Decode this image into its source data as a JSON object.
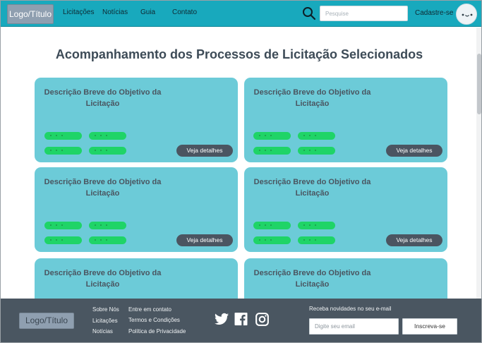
{
  "header": {
    "logo": "Logo/Título",
    "nav": [
      "Licitações",
      "Notícias",
      "Guia",
      "Contato"
    ],
    "search_placeholder": "Pesquise",
    "signup": "Cadastre-se"
  },
  "main": {
    "title": "Acompanhamento dos Processos de Licitação Selecionados",
    "cards": [
      {
        "title": "Descrição Breve do Objetivo da Licitação",
        "button": "Veja detalhes"
      },
      {
        "title": "Descrição Breve do Objetivo da Licitação",
        "button": "Veja detalhes"
      },
      {
        "title": "Descrição Breve do Objetivo da Licitação",
        "button": "Veja detalhes"
      },
      {
        "title": "Descrição Breve do Objetivo da Licitação",
        "button": "Veja detalhes"
      },
      {
        "title": "Descrição Breve do Objetivo da Licitação"
      },
      {
        "title": "Descrição Breve do Objetivo da Licitação"
      }
    ]
  },
  "footer": {
    "logo": "Logo/Título",
    "links_col1": [
      "Sobre Nós",
      "Licitações",
      "Notícias"
    ],
    "links_col2": [
      "Entre em contato",
      "Termos e Condições",
      "Política de Privacidade"
    ],
    "social": [
      "twitter-icon",
      "facebook-icon",
      "instagram-icon"
    ],
    "newsletter_label": "Receba novidades no seu e-mail",
    "email_placeholder": "Digite seu email",
    "subscribe": "Inscreva-se"
  },
  "colors": {
    "header_bg": "#18a9bd",
    "card_bg": "#6ccbd8",
    "pill": "#1fd467",
    "button_dark": "#4b5561",
    "footer_bg": "#4a5661"
  }
}
